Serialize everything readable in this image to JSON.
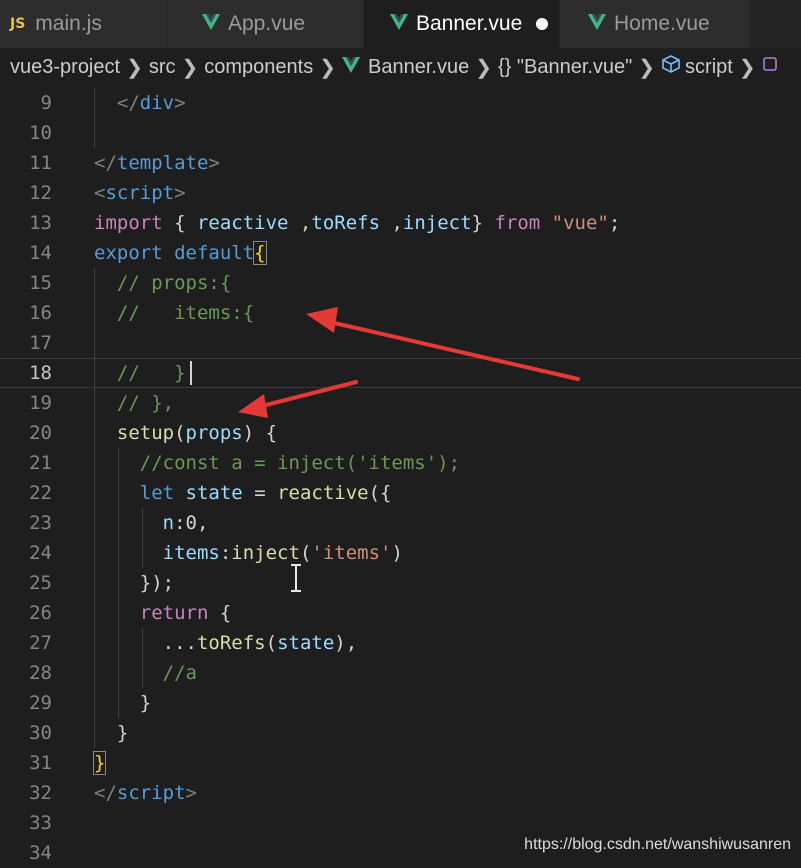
{
  "tabs": [
    {
      "label": "main.js",
      "icon": "js",
      "active": false,
      "dirty": false
    },
    {
      "label": "App.vue",
      "icon": "vue",
      "active": false,
      "dirty": false
    },
    {
      "label": "Banner.vue",
      "icon": "vue",
      "active": true,
      "dirty": true
    },
    {
      "label": "Home.vue",
      "icon": "vue",
      "active": false,
      "dirty": false
    }
  ],
  "tab_icon_js": "JS",
  "breadcrumb": [
    "vue3-project",
    "src",
    "components",
    "Banner.vue",
    "{} \"Banner.vue\"",
    "script"
  ],
  "lines": [
    {
      "n": "9"
    },
    {
      "n": "10"
    },
    {
      "n": "11"
    },
    {
      "n": "12"
    },
    {
      "n": "13"
    },
    {
      "n": "14"
    },
    {
      "n": "15"
    },
    {
      "n": "16"
    },
    {
      "n": "17"
    },
    {
      "n": "18"
    },
    {
      "n": "19"
    },
    {
      "n": "20"
    },
    {
      "n": "21"
    },
    {
      "n": "22"
    },
    {
      "n": "23"
    },
    {
      "n": "24"
    },
    {
      "n": "25"
    },
    {
      "n": "26"
    },
    {
      "n": "27"
    },
    {
      "n": "28"
    },
    {
      "n": "29"
    },
    {
      "n": "30"
    },
    {
      "n": "31"
    },
    {
      "n": "32"
    },
    {
      "n": "33"
    },
    {
      "n": "34"
    }
  ],
  "code": {
    "l9": {
      "indent": "  ",
      "a": "</",
      "b": "div",
      "c": ">"
    },
    "l11": {
      "a": "</",
      "b": "template",
      "c": ">"
    },
    "l12": {
      "a": "<",
      "b": "script",
      "c": ">"
    },
    "l13": {
      "kw": "import",
      "o": " { ",
      "n1": "reactive",
      "sp1": " ,",
      "n2": "toRefs",
      "sp2": " ,",
      "n3": "inject",
      "cl": "} ",
      "kw2": "from",
      "sp3": " ",
      "str": "\"vue\"",
      "semi": ";"
    },
    "l14": {
      "kw": "export",
      "sp": " ",
      "kw2": "default",
      "br": "{"
    },
    "l15": {
      "indent": "  ",
      "cm": "// props:{"
    },
    "l16": {
      "indent": "  ",
      "cm": "//   items:{"
    },
    "l18": {
      "indent": "  ",
      "cm": "//   }"
    },
    "l19": {
      "indent": "  ",
      "cm": "// },"
    },
    "l20": {
      "indent": "  ",
      "fn": "setup",
      "o": "(",
      "arg": "props",
      "c": ") {"
    },
    "l21": {
      "indent": "    ",
      "cm": "//const a = inject('items');"
    },
    "l22": {
      "indent": "    ",
      "kw": "let",
      "sp": " ",
      "var": "state",
      "eq": " = ",
      "fn": "reactive",
      "o": "({"
    },
    "l23": {
      "indent": "      ",
      "key": "n",
      "colon": ":",
      "num": "0",
      "comma": ","
    },
    "l24": {
      "indent": "      ",
      "key": "items",
      "colon": ":",
      "fn": "inject",
      "o": "(",
      "str": "'items'",
      "c": ")"
    },
    "l25": {
      "indent": "    ",
      "txt": "});"
    },
    "l26": {
      "indent": "    ",
      "kw": "return",
      "txt": " {"
    },
    "l27": {
      "indent": "      ",
      "spread": "...",
      "fn": "toRefs",
      "o": "(",
      "var": "state",
      "c": "),"
    },
    "l28": {
      "indent": "      ",
      "cm": "//a"
    },
    "l29": {
      "indent": "    ",
      "txt": "}"
    },
    "l30": {
      "indent": "  ",
      "txt": "}"
    },
    "l31": {
      "txt": "}"
    },
    "l32": {
      "a": "</",
      "b": "script",
      "c": ">"
    }
  },
  "watermark": "https://blog.csdn.net/wanshiwusanren",
  "colors": {
    "keyword": "#c586c0",
    "tag": "#569cd6",
    "variable": "#9cdcfe",
    "function": "#dcdcaa",
    "string": "#ce9178",
    "comment": "#6a9955",
    "arrow": "#e53935",
    "vue_icon": "#41b883",
    "js_icon": "#e2c44c"
  }
}
